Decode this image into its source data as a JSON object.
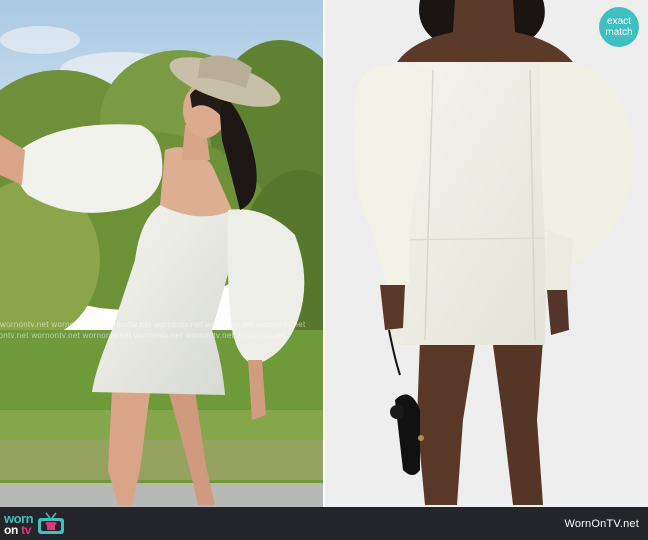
{
  "badge": {
    "line1": "exact",
    "line2": "match"
  },
  "watermark": {
    "line1": "wornontv.net  wornontv.net  wornontv.net  wornontv.net  wornontv.net  wornontv.net",
    "line2": "wornontv.net  wornontv.net  wornontv.net  wornontv.net  wornontv.net  wornontv.net"
  },
  "footer": {
    "logo_worn": "worn",
    "logo_on": "on",
    "logo_tv": "tv",
    "site_url": "WornOnTV.net"
  },
  "colors": {
    "accent": "#3fbfc0",
    "brand_pink": "#e0367d",
    "footer_bg": "#23252a",
    "dress_white": "#f4f3ea"
  },
  "images": {
    "left": "TV still: woman in cowboy hat wearing white off-shoulder puff-sleeve mini dress outdoors",
    "right": "Product photo: model wearing ivory off-shoulder puff-sleeve mini dress with black bag"
  }
}
